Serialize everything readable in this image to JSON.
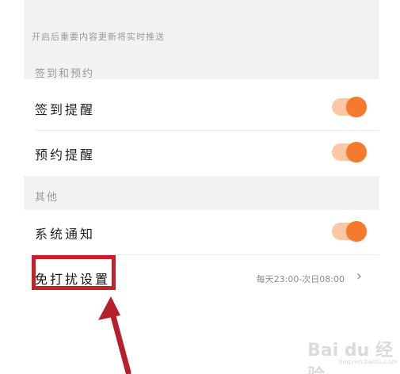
{
  "top_hint": "开启后重要内容更新将实时推送",
  "sections": {
    "checkin": {
      "label": "签到和预约",
      "items": [
        {
          "label": "签到提醒",
          "toggle_on": true
        },
        {
          "label": "预约提醒",
          "toggle_on": true
        }
      ]
    },
    "other": {
      "label": "其他",
      "items": [
        {
          "label": "系统通知",
          "toggle_on": true
        },
        {
          "label": "免打扰设置",
          "value": "每天23:00-次日08:00"
        }
      ]
    }
  },
  "colors": {
    "accent": "#f47b2e",
    "toggle_track": "#fbc7a4",
    "highlight": "#c8202a",
    "section_bg": "#f2f2f2"
  },
  "icons": {
    "chevron": "chevron-right-icon",
    "arrow": "annotation-arrow-icon"
  },
  "watermark": {
    "brand": "Bai du 经验",
    "sub": "jingyan.baidu.com"
  }
}
